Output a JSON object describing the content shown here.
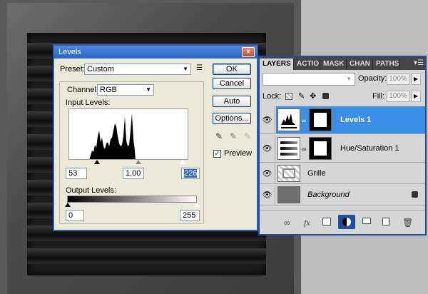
{
  "dialog": {
    "title": "Levels",
    "close_label": "x",
    "preset_label": "Preset:",
    "preset_value": "Custom",
    "channel_label": "Channel:",
    "channel_value": "RGB",
    "input_levels_label": "Input Levels:",
    "input_black": "53",
    "input_gamma": "1,00",
    "input_white": "226",
    "output_levels_label": "Output Levels:",
    "output_black": "0",
    "output_white": "255",
    "buttons": {
      "ok": "OK",
      "cancel": "Cancel",
      "auto": "Auto",
      "options": "Options..."
    },
    "preview_label": "Preview",
    "preview_checked": true
  },
  "layers_panel": {
    "tabs": [
      "LAYERS",
      "ACTIO",
      "MASK",
      "CHAN",
      "PATHS"
    ],
    "opacity_label": "Opacity:",
    "opacity_value": "100%",
    "lock_label": "Lock:",
    "fill_label": "Fill:",
    "fill_value": "100%",
    "layers": [
      {
        "name": "Levels 1",
        "selected": true,
        "italic": false
      },
      {
        "name": "Hue/Saturation 1",
        "selected": false,
        "italic": false
      },
      {
        "name": "Grille",
        "selected": false,
        "italic": false
      },
      {
        "name": "Background",
        "selected": false,
        "italic": true
      }
    ],
    "bottom_icons": [
      "link-icon",
      "fx-icon",
      "mask-icon",
      "adjustment-icon",
      "folder-icon",
      "new-layer-icon",
      "trash-icon"
    ]
  },
  "colors": {
    "selected_layer": "#3a8ee6",
    "dialog_title": "#2b63c6",
    "panel_tabs": "#464646"
  }
}
